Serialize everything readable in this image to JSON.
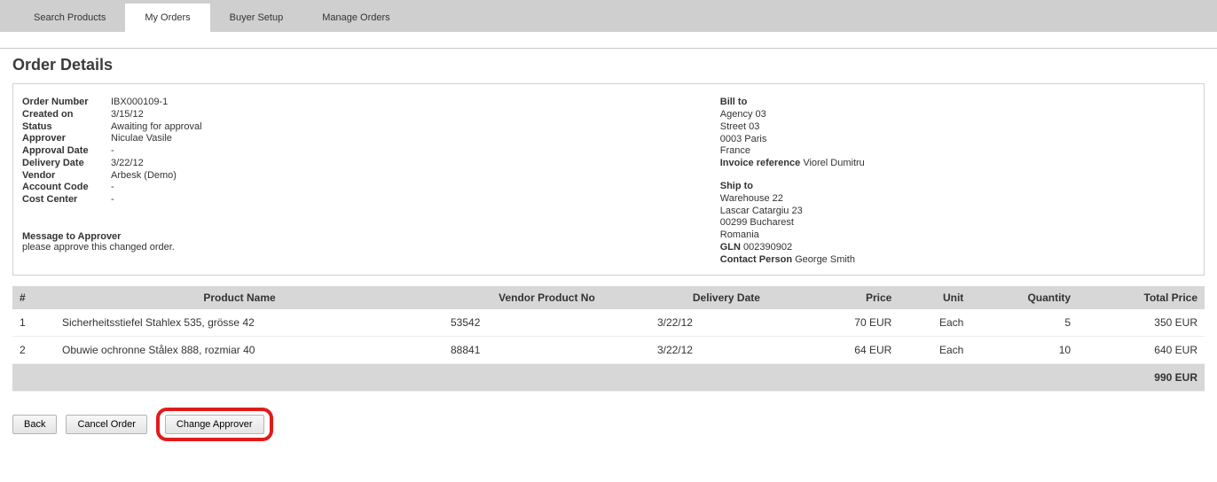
{
  "tabs": [
    {
      "label": "Search Products"
    },
    {
      "label": "My Orders"
    },
    {
      "label": "Buyer Setup"
    },
    {
      "label": "Manage Orders"
    }
  ],
  "active_tab_index": 1,
  "page_title": "Order Details",
  "order": {
    "number_label": "Order Number",
    "number": "IBX000109-1",
    "created_label": "Created on",
    "created": "3/15/12",
    "status_label": "Status",
    "status": "Awaiting for approval",
    "approver_label": "Approver",
    "approver": "Niculae Vasile",
    "approval_date_label": "Approval Date",
    "approval_date": "-",
    "delivery_date_label": "Delivery Date",
    "delivery_date": "3/22/12",
    "vendor_label": "Vendor",
    "vendor": "Arbesk (Demo)",
    "account_code_label": "Account Code",
    "account_code": "-",
    "cost_center_label": "Cost Center",
    "cost_center": "-"
  },
  "bill_to": {
    "header": "Bill to",
    "lines": [
      "Agency 03",
      "Street 03",
      "0003  Paris",
      "France"
    ],
    "invoice_ref_label": "Invoice reference",
    "invoice_ref": "Viorel Dumitru"
  },
  "ship_to": {
    "header": "Ship to",
    "lines": [
      "Warehouse 22",
      "Lascar Catargiu 23",
      "00299  Bucharest",
      "Romania"
    ],
    "gln_label": "GLN",
    "gln": "002390902",
    "contact_label": "Contact Person",
    "contact": "George Smith"
  },
  "message": {
    "label": "Message to Approver",
    "text": "please approve this changed order."
  },
  "table": {
    "headers": {
      "idx": "#",
      "product_name": "Product Name",
      "vendor_no": "Vendor Product No",
      "delivery_date": "Delivery Date",
      "price": "Price",
      "unit": "Unit",
      "quantity": "Quantity",
      "total": "Total Price"
    },
    "rows": [
      {
        "idx": "1",
        "product_name": "Sicherheitsstiefel Stahlex 535, grösse 42",
        "vendor_no": "53542",
        "delivery_date": "3/22/12",
        "price": "70 EUR",
        "unit": "Each",
        "quantity": "5",
        "total": "350 EUR"
      },
      {
        "idx": "2",
        "product_name": "Obuwie ochronne Stålex 888, rozmiar 40",
        "vendor_no": "88841",
        "delivery_date": "3/22/12",
        "price": "64 EUR",
        "unit": "Each",
        "quantity": "10",
        "total": "640 EUR"
      }
    ],
    "grand_total": "990 EUR"
  },
  "buttons": {
    "back": "Back",
    "cancel": "Cancel Order",
    "change_approver": "Change Approver"
  }
}
